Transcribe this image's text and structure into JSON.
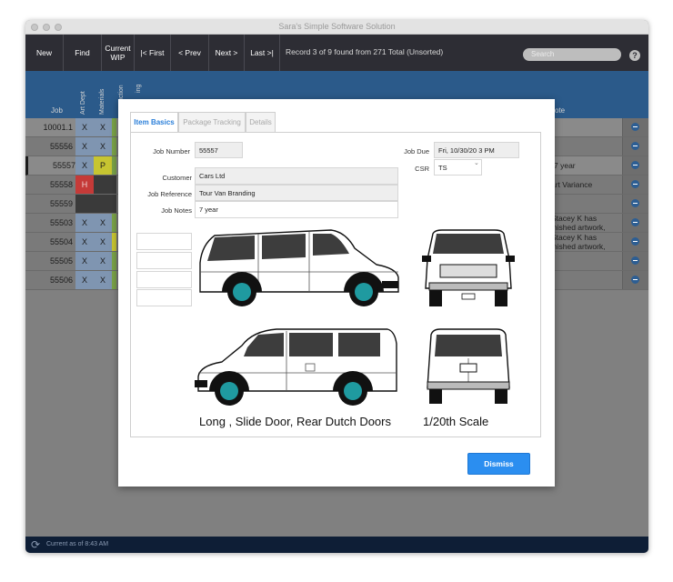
{
  "window": {
    "title": "Sara's Simple Software Solution"
  },
  "toolbar": {
    "new_label": "New",
    "find_label": "Find",
    "wip_label": "Current WIP",
    "first_label": "|< First",
    "prev_label": "< Prev",
    "next_label": "Next >",
    "last_label": "Last >|",
    "status": "Record 3 of 9 found from 271 Total (Unsorted)",
    "search_placeholder": "Search",
    "help_label": "?"
  },
  "columns": {
    "job": "Job",
    "art_dept": "Art Dept",
    "materials": "Materials",
    "production": "uction",
    "tracking": "ing",
    "note": "ote"
  },
  "rows": [
    {
      "job": "10001.1",
      "art": "X",
      "mat": "X",
      "note1": "",
      "note2": ""
    },
    {
      "job": "55556",
      "art": "X",
      "mat": "X",
      "note1": "",
      "note2": ""
    },
    {
      "job": "55557",
      "art": "X",
      "mat": "P",
      "note1": "7 year",
      "note2": ""
    },
    {
      "job": "55558",
      "art": "H",
      "mat": "",
      "note1": "art Variance",
      "note2": ""
    },
    {
      "job": "55559",
      "art": "",
      "mat": "",
      "note1": "",
      "note2": ""
    },
    {
      "job": "55503",
      "art": "X",
      "mat": "X",
      "note1": "Stacey K has",
      "note2": "inished artwork,"
    },
    {
      "job": "55504",
      "art": "X",
      "mat": "X",
      "note1": "Stacey K has",
      "note2": "inished artwork,"
    },
    {
      "job": "55505",
      "art": "X",
      "mat": "X",
      "note1": "",
      "note2": ""
    },
    {
      "job": "55506",
      "art": "X",
      "mat": "X",
      "note1": "",
      "note2": ""
    }
  ],
  "modal": {
    "tabs": [
      "Item Basics",
      "Package Tracking",
      "Details"
    ],
    "active_tab": "Item Basics",
    "job_number_label": "Job Number",
    "job_number": "55557",
    "job_due_label": "Job Due",
    "job_due": "Fri, 10/30/20    3 PM",
    "csr_label": "CSR",
    "csr": "TS",
    "customer_label": "Customer",
    "customer": "Cars Ltd",
    "job_reference_label": "Job Reference",
    "job_reference": "Tour Van Branding",
    "job_notes_label": "Job Notes",
    "job_notes": "7 year",
    "caption_left": "Long , Slide Door, Rear Dutch Doors",
    "caption_right": "1/20th Scale",
    "dismiss_label": "Dismiss"
  },
  "footer": {
    "status": "Current as of 8:43 AM"
  },
  "colors": {
    "toolbar_bg": "#2d2d34",
    "header_bg": "#2b5a8a",
    "accent": "#2b8ef0",
    "cell_blue": "#7f95b1",
    "cell_green": "#7aa248",
    "cell_yellow": "#c7c531",
    "cell_red": "#c53a38"
  }
}
